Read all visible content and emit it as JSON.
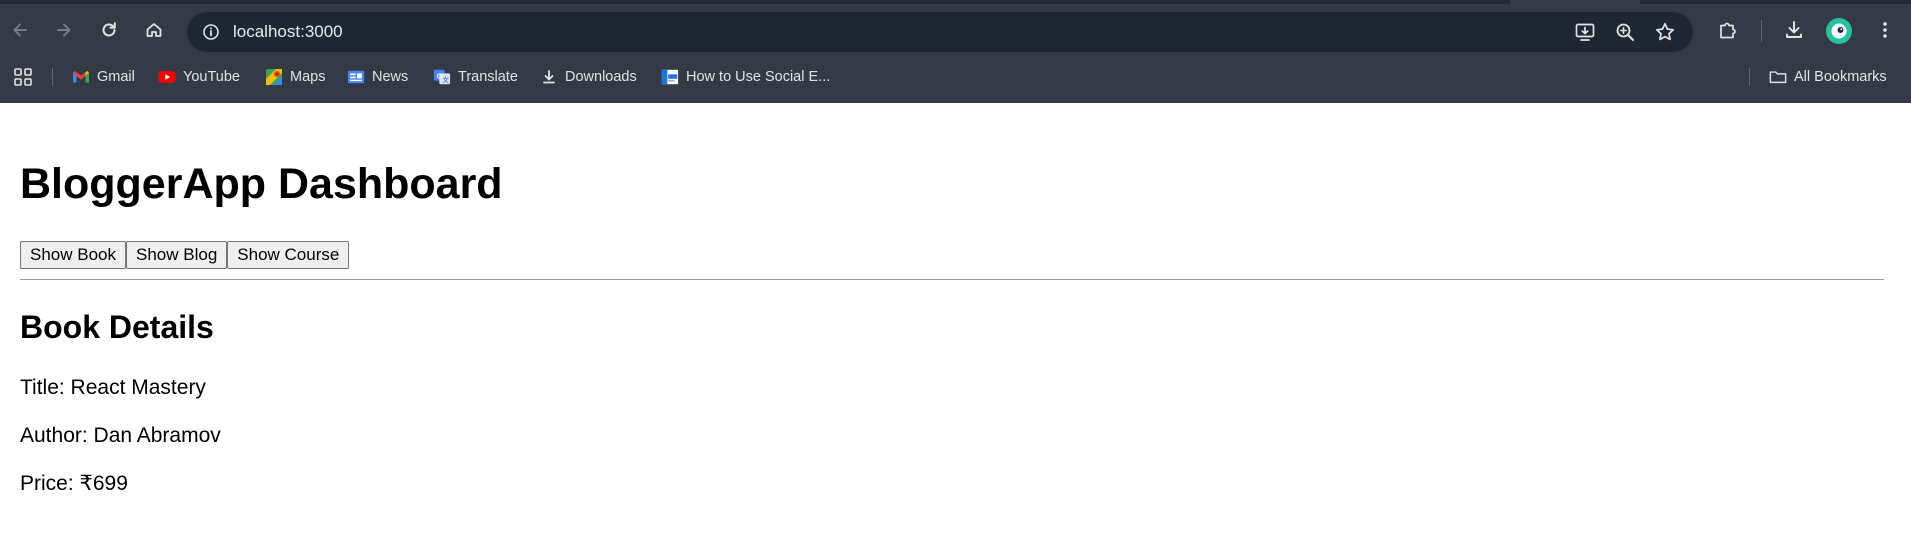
{
  "browser": {
    "url": "localhost:3000",
    "bookmarks": [
      {
        "label": "Gmail",
        "icon": "gmail-icon"
      },
      {
        "label": "YouTube",
        "icon": "youtube-icon"
      },
      {
        "label": "Maps",
        "icon": "maps-icon"
      },
      {
        "label": "News",
        "icon": "news-icon"
      },
      {
        "label": "Translate",
        "icon": "translate-icon"
      },
      {
        "label": "Downloads",
        "icon": "download-icon"
      },
      {
        "label": "How to Use Social E...",
        "icon": "page-favicon"
      }
    ],
    "all_bookmarks_label": "All Bookmarks",
    "colors": {
      "frame": "#343b47",
      "omnibox": "#202734",
      "avatar": "#25c2a0"
    }
  },
  "page": {
    "title": "BloggerApp Dashboard",
    "buttons": {
      "show_book": "Show Book",
      "show_blog": "Show Blog",
      "show_course": "Show Course"
    },
    "section_title": "Book Details",
    "details": {
      "title_line": "Title: React Mastery",
      "author_line": "Author: Dan Abramov",
      "price_line": "Price: ₹699"
    }
  }
}
